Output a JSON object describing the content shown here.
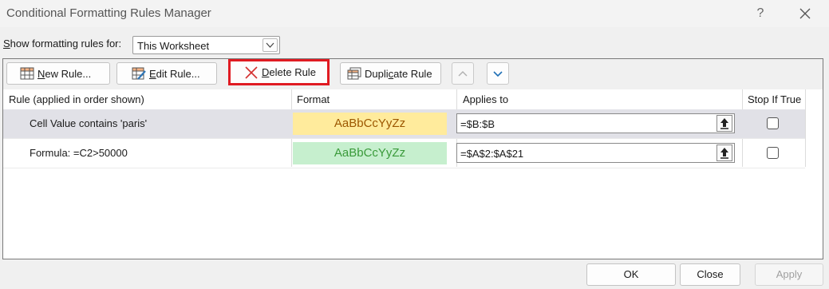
{
  "window": {
    "title": "Conditional Formatting Rules Manager",
    "help_label": "?"
  },
  "show_rules": {
    "label_prefix": "S",
    "label_rest": "how formatting rules for:",
    "selected": "This Worksheet"
  },
  "toolbar": {
    "new_rule": {
      "mnemonic": "N",
      "rest": "ew Rule..."
    },
    "edit_rule": {
      "mnemonic": "E",
      "rest": "dit Rule..."
    },
    "delete_rule": {
      "mnemonic": "D",
      "rest": "elete Rule"
    },
    "duplicate_rule": {
      "before": "Dupli",
      "mnemonic": "c",
      "after": "ate Rule"
    }
  },
  "columns": {
    "rule": "Rule (applied in order shown)",
    "format": "Format",
    "applies_to": "Applies to",
    "stop_if_true": "Stop If True"
  },
  "rules": [
    {
      "rule": "Cell Value contains 'paris'",
      "format_preview": "AaBbCcYyZz",
      "applies_to": "=$B:$B",
      "stop_if_true": false,
      "selected": true
    },
    {
      "rule": "Formula: =C2>50000",
      "format_preview": "AaBbCcYyZz",
      "applies_to": "=$A$2:$A$21",
      "stop_if_true": false,
      "selected": false
    }
  ],
  "footer": {
    "ok": "OK",
    "close": "Close",
    "apply": "Apply"
  },
  "colors": {
    "highlight_border": "#e01b22",
    "format1_fill": "#ffeb9c",
    "format1_text": "#9c5700",
    "format2_fill": "#c6efce",
    "format2_text": "#3a9a3a",
    "selected_row": "#e1e1e7"
  }
}
